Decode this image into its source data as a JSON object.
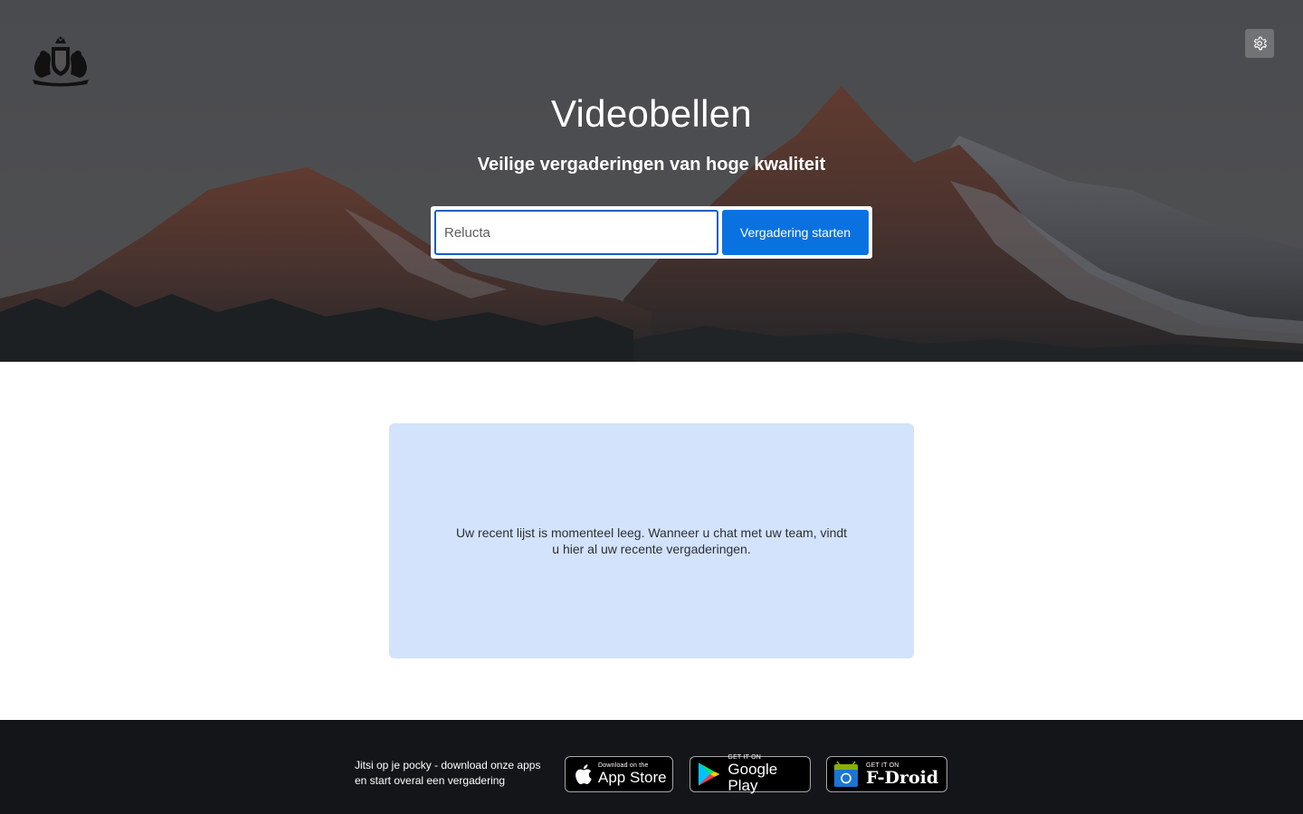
{
  "header": {
    "title": "Videobellen",
    "subtitle": "Veilige vergaderingen van hoge kwaliteit",
    "logo_icon": "dutch-coat-of-arms-icon",
    "settings_icon": "gear-icon"
  },
  "enter_room": {
    "input_value": "Relucta",
    "start_button_label": "Vergadering starten"
  },
  "recent": {
    "empty_message": "Uw recent lijst is momenteel leeg. Wanneer u chat met uw team, vindt u hier al uw recente vergaderingen."
  },
  "footer": {
    "promo_text": "Jitsi op je pocky - download onze apps en start overal een vergadering",
    "badges": {
      "app_store": {
        "small": "Download on the",
        "big": "App Store",
        "icon": "apple-icon"
      },
      "google_play": {
        "small": "GET IT ON",
        "big": "Google Play",
        "icon": "google-play-icon"
      },
      "fdroid": {
        "small": "GET IT ON",
        "big": "F-Droid",
        "icon": "fdroid-icon"
      }
    }
  },
  "colors": {
    "accent": "#0a72e0",
    "recent_bg": "#d3e3fb",
    "footer_bg": "#131519"
  }
}
